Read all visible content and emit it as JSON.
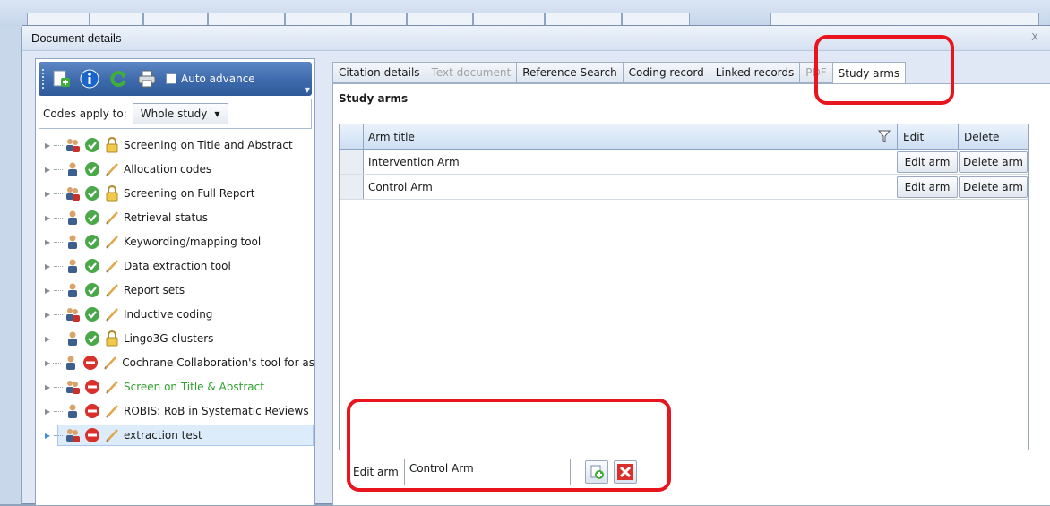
{
  "dialog": {
    "title": "Document details",
    "close_glyph": "X"
  },
  "toolbar": {
    "auto_advance_label": "Auto advance"
  },
  "codes": {
    "label": "Codes apply to:",
    "selected": "Whole study"
  },
  "tree": {
    "items": [
      {
        "label": "Screening on Title and Abstract",
        "person": "group",
        "status": "check",
        "mode": "lock",
        "color": ""
      },
      {
        "label": "Allocation codes",
        "person": "single",
        "status": "check",
        "mode": "pencil",
        "color": ""
      },
      {
        "label": "Screening on Full Report",
        "person": "group",
        "status": "check",
        "mode": "lock",
        "color": ""
      },
      {
        "label": "Retrieval status",
        "person": "single",
        "status": "check",
        "mode": "pencil",
        "color": ""
      },
      {
        "label": "Keywording/mapping tool",
        "person": "single",
        "status": "check",
        "mode": "pencil",
        "color": ""
      },
      {
        "label": "Data extraction tool",
        "person": "single",
        "status": "check",
        "mode": "pencil",
        "color": ""
      },
      {
        "label": "Report sets",
        "person": "single",
        "status": "check",
        "mode": "pencil",
        "color": ""
      },
      {
        "label": "Inductive coding",
        "person": "group",
        "status": "check",
        "mode": "pencil",
        "color": ""
      },
      {
        "label": "Lingo3G clusters",
        "person": "single",
        "status": "check",
        "mode": "lock",
        "color": ""
      },
      {
        "label": "Cochrane Collaboration's tool for as",
        "person": "single",
        "status": "stop",
        "mode": "pencil",
        "color": ""
      },
      {
        "label": "Screen on Title & Abstract",
        "person": "group",
        "status": "stop",
        "mode": "pencil",
        "color": "green"
      },
      {
        "label": "ROBIS: RoB in Systematic Reviews",
        "person": "single",
        "status": "stop",
        "mode": "pencil",
        "color": ""
      },
      {
        "label": "extraction test",
        "person": "group",
        "status": "stop",
        "mode": "pencil",
        "color": "",
        "selected": true
      }
    ]
  },
  "tabs": [
    {
      "label": "Citation details",
      "state": "normal"
    },
    {
      "label": "Text document",
      "state": "disabled"
    },
    {
      "label": "Reference Search",
      "state": "normal"
    },
    {
      "label": "Coding record",
      "state": "normal"
    },
    {
      "label": "Linked records",
      "state": "normal"
    },
    {
      "label": "PDF",
      "state": "disabled"
    },
    {
      "label": "Study arms",
      "state": "active"
    }
  ],
  "study_arms": {
    "title": "Study arms",
    "columns": {
      "arm_title": "Arm title",
      "edit": "Edit",
      "delete": "Delete"
    },
    "rows": [
      {
        "title": "Intervention Arm",
        "edit_btn": "Edit arm",
        "delete_btn": "Delete arm"
      },
      {
        "title": "Control Arm",
        "edit_btn": "Edit arm",
        "delete_btn": "Delete arm"
      }
    ],
    "editor": {
      "label": "Edit arm",
      "value": "Control Arm"
    }
  },
  "colors": {
    "highlight": "#e8151f",
    "toolbar": "#3d6aac",
    "green_text": "#2fa12f"
  }
}
